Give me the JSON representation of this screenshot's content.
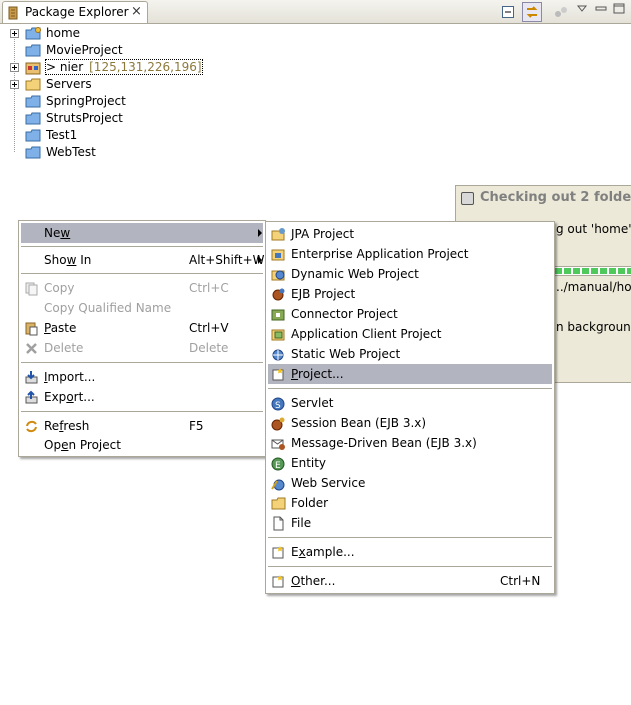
{
  "tab": {
    "title": "Package Explorer",
    "close_icon": "×"
  },
  "toolbar": {
    "icons": [
      "collapse-all-icon",
      "link-with-editor-icon",
      "view-menu-icon",
      "minimize-icon",
      "maximize-icon"
    ]
  },
  "tree": [
    {
      "label": "home",
      "decoration": ""
    },
    {
      "label": "MovieProject",
      "decoration": ""
    },
    {
      "label": "> nier",
      "decoration": "[125,131,226,196]"
    },
    {
      "label": "Servers",
      "decoration": ""
    },
    {
      "label": "SpringProject",
      "decoration": ""
    },
    {
      "label": "StrutsProject",
      "decoration": ""
    },
    {
      "label": "Test1",
      "decoration": ""
    },
    {
      "label": "WebTest",
      "decoration": ""
    }
  ],
  "popup": {
    "title": "Checking out 2 folder",
    "line1": "g out 'home'",
    "line2": "../manual/ho",
    "line3": "n background",
    "progress": 1.0
  },
  "context_menu": {
    "new": {
      "label": "New",
      "u": "w"
    },
    "show_in": {
      "label": "Show In",
      "accel": "Alt+Shift+W"
    },
    "copy": {
      "label": "Copy",
      "accel": "Ctrl+C"
    },
    "copy_qualified": {
      "label": "Copy Qualified Name"
    },
    "paste": {
      "label": "Paste",
      "accel": "Ctrl+V"
    },
    "delete": {
      "label": "Delete",
      "accel": "Delete"
    },
    "import": {
      "label": "Import..."
    },
    "export": {
      "label": "Export..."
    },
    "refresh": {
      "label": "Refresh",
      "accel": "F5"
    },
    "open_project": {
      "label": "Open Project"
    }
  },
  "new_submenu": {
    "jpa": "JPA Project",
    "ear": "Enterprise Application Project",
    "dyn": "Dynamic Web Project",
    "ejb": "EJB Project",
    "connector": "Connector Project",
    "appclient": "Application Client Project",
    "static": "Static Web Project",
    "project": "Project...",
    "servlet": "Servlet",
    "session": "Session Bean (EJB 3.x)",
    "mdb": "Message-Driven Bean (EJB 3.x)",
    "entity": "Entity",
    "webservice": "Web Service",
    "folder": "Folder",
    "file": "File",
    "example": "Example...",
    "other": "Other...",
    "other_accel": "Ctrl+N"
  }
}
